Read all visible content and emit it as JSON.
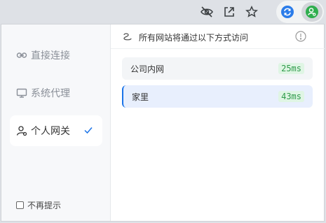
{
  "toolbar": {
    "icons": [
      "eye-off-icon",
      "share-icon",
      "star-icon",
      "extension-refresh-icon",
      "extension-user-icon"
    ]
  },
  "sidebar": {
    "items": [
      {
        "label": "直接连接",
        "icon": "link-icon",
        "active": false
      },
      {
        "label": "系统代理",
        "icon": "monitor-icon",
        "active": false
      },
      {
        "label": "个人网关",
        "icon": "person-gateway-icon",
        "active": true
      }
    ],
    "dont_show_label": "不再提示",
    "dont_show_checked": false
  },
  "main": {
    "header": "所有网站将通过以下方式访问",
    "gateways": [
      {
        "name": "公司内网",
        "latency": "25ms",
        "selected": false
      },
      {
        "name": "家里",
        "latency": "43ms",
        "selected": true
      }
    ]
  },
  "colors": {
    "accent": "#1a73e8",
    "latency_bg": "#dff5e4",
    "latency_fg": "#2e9a4a",
    "selected_bg": "#e8effd"
  }
}
